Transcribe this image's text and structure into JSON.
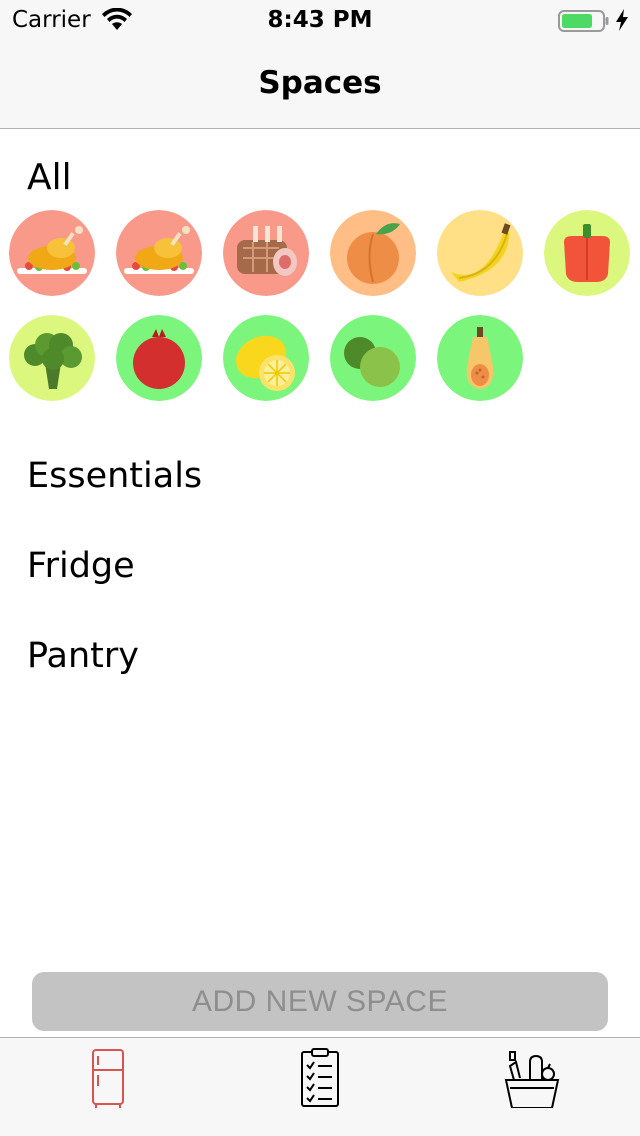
{
  "status_bar": {
    "carrier": "Carrier",
    "time": "8:43 PM"
  },
  "nav": {
    "title": "Spaces"
  },
  "all_section": {
    "label": "All",
    "items": [
      {
        "name": "roast-chicken-icon",
        "bg": "#f9998a"
      },
      {
        "name": "roast-chicken-icon",
        "bg": "#f9998a"
      },
      {
        "name": "rack-of-lamb-icon",
        "bg": "#f9998a"
      },
      {
        "name": "peach-icon",
        "bg": "#ffbe85"
      },
      {
        "name": "banana-icon",
        "bg": "#ffe087"
      },
      {
        "name": "bell-pepper-icon",
        "bg": "#dcf77e"
      },
      {
        "name": "broccoli-icon",
        "bg": "#dcf77e"
      },
      {
        "name": "pomegranate-icon",
        "bg": "#7cf57c"
      },
      {
        "name": "lemon-icon",
        "bg": "#7cf57c"
      },
      {
        "name": "limes-icon",
        "bg": "#7cf57c"
      },
      {
        "name": "butternut-squash-icon",
        "bg": "#7cf57c"
      }
    ]
  },
  "spaces": [
    "Essentials",
    "Fridge",
    "Pantry"
  ],
  "add_button": {
    "label": "ADD NEW SPACE"
  },
  "tabs": [
    {
      "name": "fridge-icon",
      "color": "#d9534f",
      "selected": true
    },
    {
      "name": "checklist-icon",
      "color": "#000000",
      "selected": false
    },
    {
      "name": "grocery-basket-icon",
      "color": "#000000",
      "selected": false
    }
  ]
}
